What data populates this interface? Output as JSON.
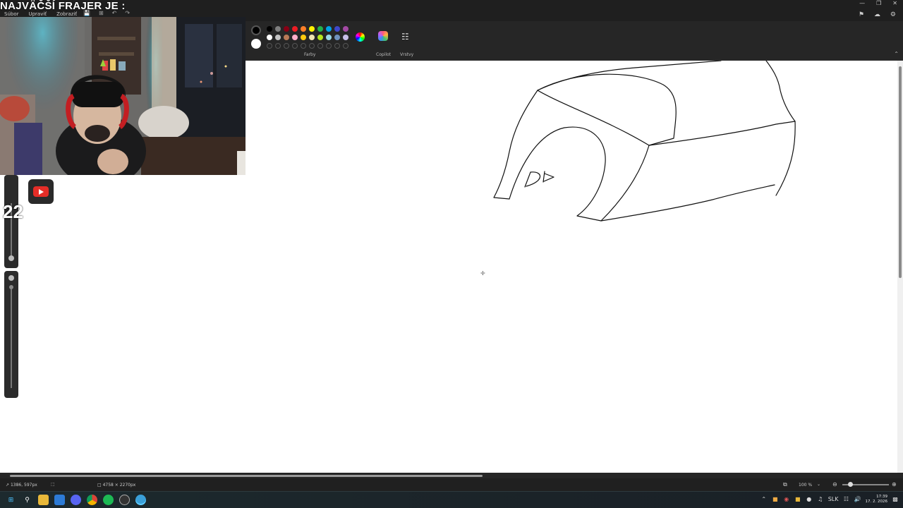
{
  "overlay": {
    "title": "NAJVÄČŠÍ FRAJER JE :",
    "counter": "22"
  },
  "menu": {
    "items": [
      "Súbor",
      "Upraviť",
      "Zobraziť"
    ]
  },
  "ribbon": {
    "colors_label": "Farby",
    "copilot_label": "Copilot",
    "layers_label": "Vrstvy",
    "primary_color": "#000000",
    "secondary_color": "#ffffff",
    "palette_row1": [
      "#000000",
      "#7f7f7f",
      "#880015",
      "#ed1c24",
      "#ff7f27",
      "#fff200",
      "#22b14c",
      "#00a2e8",
      "#3f48cc",
      "#a349a4"
    ],
    "palette_row2": [
      "#ffffff",
      "#c3c3c3",
      "#b97a57",
      "#ffaec9",
      "#ffc90e",
      "#efe4b0",
      "#b5e61d",
      "#99d9ea",
      "#7092be",
      "#c8bfe7"
    ]
  },
  "canvas": {
    "text_scribble": "Db"
  },
  "status": {
    "cursor_pos": "1386, 597px",
    "canvas_size": "4758 × 2270px",
    "zoom": "100 %"
  },
  "taskbar": {
    "lang": "SLK",
    "time": "17:39",
    "date": "17. 2. 2026"
  },
  "icons": [
    "save-icon",
    "undo-icon",
    "redo-icon",
    "layers-icon",
    "copilot-icon",
    "color-wheel-icon",
    "youtube-icon",
    "windows-start-icon",
    "search-icon"
  ]
}
